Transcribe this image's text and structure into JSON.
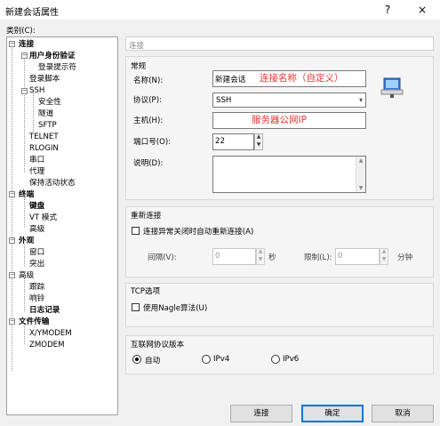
{
  "window": {
    "title": "新建会话属性",
    "help_symbol": "?",
    "close_symbol": "×"
  },
  "category_label": "类别(C):",
  "tree": [
    {
      "label": "连接",
      "bold": true
    },
    {
      "label": "用户身份验证",
      "bold": true
    },
    {
      "label": "登录提示符",
      "bold": false
    },
    {
      "label": "登录脚本",
      "bold": false
    },
    {
      "label": "SSH",
      "bold": false
    },
    {
      "label": "安全性",
      "bold": false
    },
    {
      "label": "隧道",
      "bold": false
    },
    {
      "label": "SFTP",
      "bold": false
    },
    {
      "label": "TELNET",
      "bold": false
    },
    {
      "label": "RLOGIN",
      "bold": false
    },
    {
      "label": "串口",
      "bold": false
    },
    {
      "label": "代理",
      "bold": false
    },
    {
      "label": "保持活动状态",
      "bold": false
    },
    {
      "label": "终端",
      "bold": true
    },
    {
      "label": "键盘",
      "bold": true
    },
    {
      "label": "VT 模式",
      "bold": false
    },
    {
      "label": "高级",
      "bold": false
    },
    {
      "label": "外观",
      "bold": true
    },
    {
      "label": "窗口",
      "bold": false
    },
    {
      "label": "突出",
      "bold": false
    },
    {
      "label": "高级",
      "bold": false
    },
    {
      "label": "跟踪",
      "bold": false
    },
    {
      "label": "响铃",
      "bold": false
    },
    {
      "label": "日志记录",
      "bold": true
    },
    {
      "label": "文件传输",
      "bold": true
    },
    {
      "label": "X/YMODEM",
      "bold": false
    },
    {
      "label": "ZMODEM",
      "bold": false
    }
  ],
  "breadcrumb": "连接",
  "general": {
    "title": "常规",
    "name_label": "名称(N):",
    "name_value": "新建会话",
    "name_annotation": "连接名称（自定义）",
    "protocol_label": "协议(P):",
    "protocol_value": "SSH",
    "host_label": "主机(H):",
    "host_value": "",
    "host_annotation": "服务器公网IP",
    "port_label": "端口号(O):",
    "port_value": "22",
    "desc_label": "说明(D):",
    "desc_value": ""
  },
  "reconnect": {
    "title": "重新连接",
    "checkbox_label": "连接异常关闭时自动重新连接(A)",
    "interval_label": "间隔(V):",
    "interval_value": "0",
    "interval_unit": "秒",
    "limit_label": "限制(L):",
    "limit_value": "0",
    "limit_unit": "分钟"
  },
  "tcp": {
    "title": "TCP选项",
    "nagle_label": "使用Nagle算法(U)"
  },
  "ip": {
    "title": "互联网协议版本",
    "options": [
      "自动",
      "IPv4",
      "IPv6"
    ],
    "selected": "自动"
  },
  "buttons": {
    "connect": "连接",
    "ok": "确定",
    "cancel": "取消"
  }
}
